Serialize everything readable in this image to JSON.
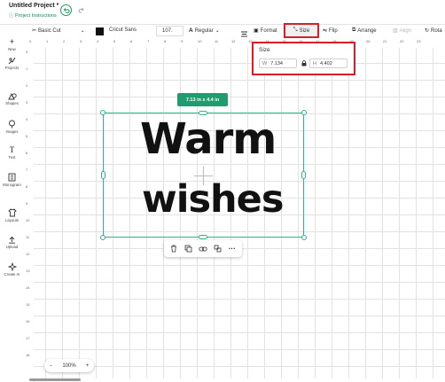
{
  "header": {
    "title": "Untitled Project *",
    "subtitle": "Project Instructions"
  },
  "toolbar": {
    "operation": "Basic Cut",
    "font": "Cricut Sans",
    "font_size": "107.",
    "style": "Regular",
    "format_label": "Format",
    "size_label": "Size",
    "flip_label": "Flip",
    "arrange_label": "Arrange",
    "align_label": "Align",
    "rotate_label": "Rota",
    "color_swatch": "#111111"
  },
  "sidebar": {
    "items": [
      {
        "label": "New",
        "icon": "plus-icon"
      },
      {
        "label": "Projects",
        "icon": "projects-icon"
      },
      {
        "label": "Shapes",
        "icon": "shapes-icon"
      },
      {
        "label": "Images",
        "icon": "images-icon"
      },
      {
        "label": "Text",
        "icon": "text-icon"
      },
      {
        "label": "Monogram",
        "icon": "monogram-icon"
      },
      {
        "label": "Layouts",
        "icon": "layouts-icon"
      },
      {
        "label": "Upload",
        "icon": "upload-icon"
      },
      {
        "label": "Create AI",
        "icon": "sparkle-icon"
      }
    ]
  },
  "ruler": {
    "top": [
      "0",
      "1",
      "2",
      "3",
      "4",
      "5",
      "6",
      "7",
      "8",
      "9",
      "10",
      "11",
      "12",
      "13",
      "14",
      "15",
      "16",
      "17",
      "18",
      "19",
      "20",
      "21",
      "22",
      "23"
    ],
    "left": [
      "0",
      "1",
      "2",
      "3",
      "4",
      "5",
      "6",
      "7",
      "8",
      "9",
      "10",
      "11",
      "12",
      "13",
      "14",
      "15",
      "16",
      "17",
      "18"
    ]
  },
  "canvas": {
    "dimension_badge": "7.13  in x 4.4  in",
    "text_line1": "Warm",
    "text_line2": "wishes"
  },
  "size_panel": {
    "title": "Size",
    "width_label": "W",
    "width_value": "7.134",
    "height_label": "H",
    "height_value": "4.402"
  },
  "zoom": {
    "value": "100%",
    "minus": "−",
    "plus": "+"
  },
  "colors": {
    "accent": "#1f9d6e",
    "highlight": "#d71f2a",
    "selection": "#2bb58a"
  }
}
